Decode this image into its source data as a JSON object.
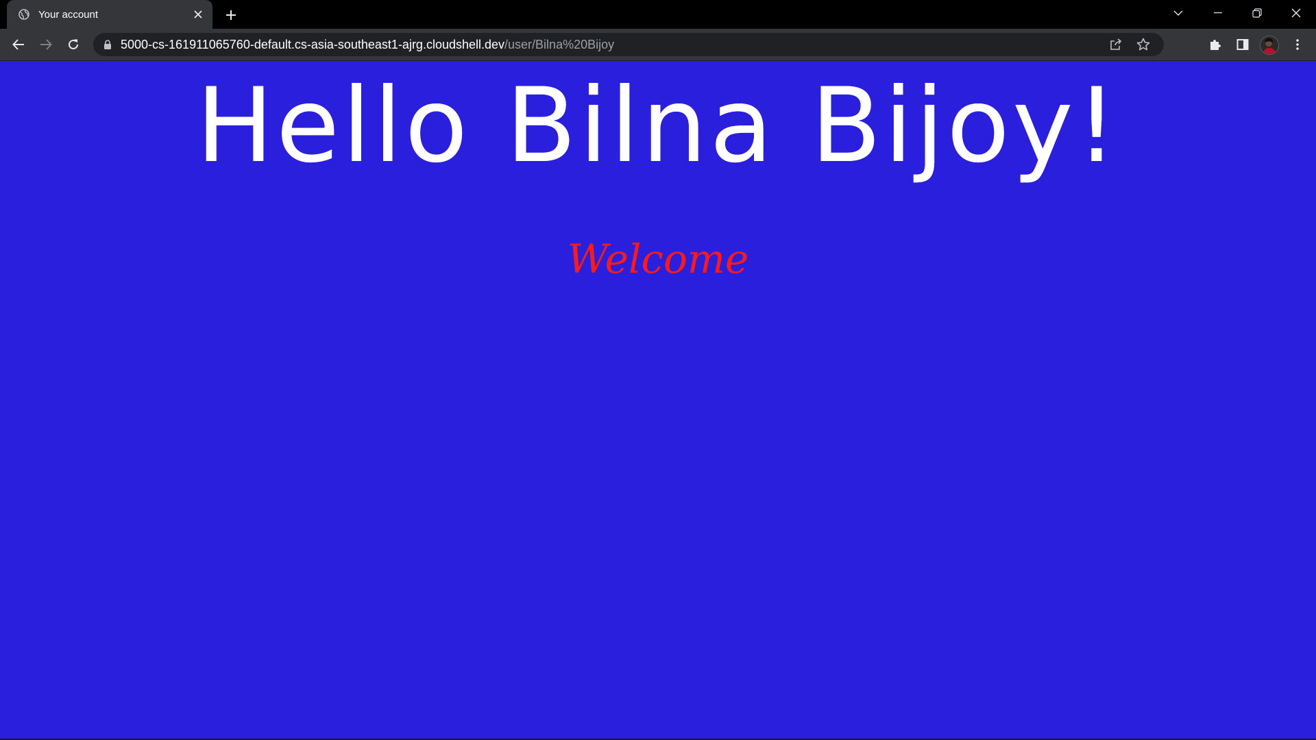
{
  "browser": {
    "tab": {
      "title": "Your account",
      "favicon": "globe-icon"
    },
    "address": {
      "host": "5000-cs-161911065760-default.cs-asia-southeast1-ajrg.cloudshell.dev",
      "path": "/user/Bilna%20Bijoy"
    }
  },
  "page": {
    "greeting": "Hello Bilna Bijoy!",
    "welcome": "Welcome"
  },
  "colors": {
    "page_background": "#2b1fde",
    "greeting_text": "#ffffff",
    "welcome_text": "#ff1a1a"
  }
}
